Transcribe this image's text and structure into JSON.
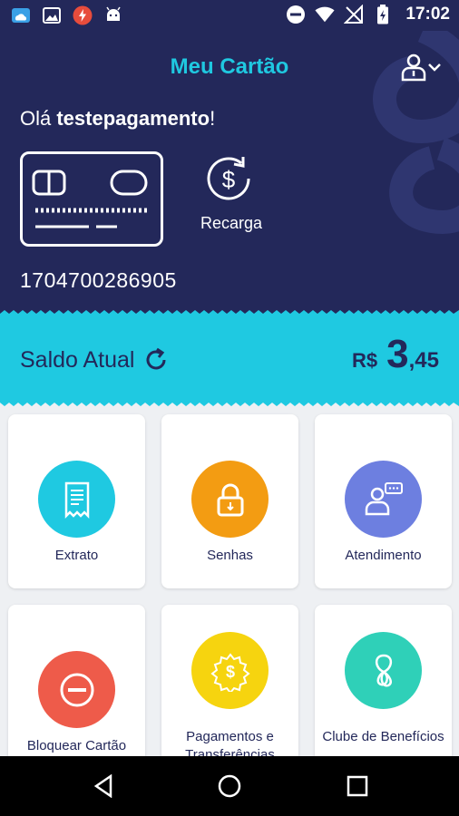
{
  "status_bar": {
    "time": "17:02",
    "icons": [
      "cloud-icon",
      "image-icon",
      "flash-icon",
      "android-icon",
      "do-not-disturb-icon",
      "wifi-icon",
      "no-signal-icon",
      "battery-icon"
    ]
  },
  "header": {
    "title": "Meu Cartão",
    "greeting_prefix": "Olá ",
    "username": "testepagamento",
    "greeting_suffix": "!",
    "recharge_label": "Recarga",
    "card_number": "1704700286905"
  },
  "balance": {
    "label": "Saldo Atual",
    "currency": "R$",
    "integer": "3",
    "decimal": ",45"
  },
  "menu": [
    {
      "label": "Extrato",
      "color": "#1fc9e1",
      "icon": "receipt-icon"
    },
    {
      "label": "Senhas",
      "color": "#f39c12",
      "icon": "lock-icon"
    },
    {
      "label": "Atendimento",
      "color": "#6d7fe0",
      "icon": "support-chat-icon"
    },
    {
      "label": "Bloquear Cartão",
      "color": "#ee5b4a",
      "icon": "block-icon"
    },
    {
      "label": "Pagamentos e Transferências",
      "color": "#f6d40f",
      "icon": "payment-gear-icon"
    },
    {
      "label": "Clube de Benefícios",
      "color": "#2fd0b8",
      "icon": "benefits-clover-icon"
    }
  ],
  "colors": {
    "navy": "#23285a",
    "cyan": "#1fc9e1"
  },
  "nav_bar": [
    "back-icon",
    "home-icon",
    "recents-icon"
  ]
}
